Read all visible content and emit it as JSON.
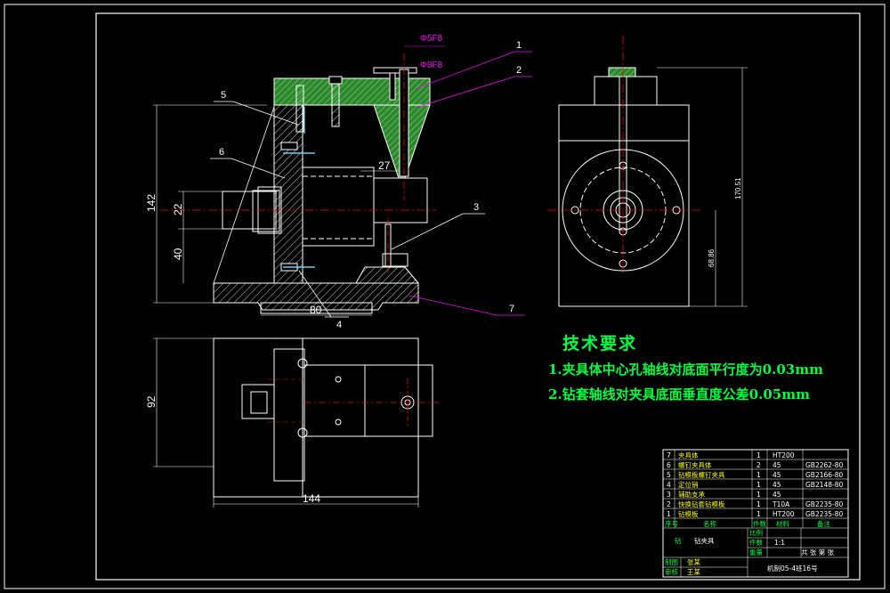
{
  "tech_requirements": {
    "title": "技术要求",
    "lines": [
      "1.夹具体中心孔轴线对底面平行度为0.03mm",
      "2.钻套轴线对夹具底面垂直度公差0.05mm"
    ]
  },
  "dimensions": {
    "fit_outer": "Φ5F8",
    "fit_inner": "Φ8F8",
    "d27": "27",
    "d22": "22",
    "d142": "142",
    "d40": "40",
    "d80": "80",
    "d92": "92",
    "d144": "144",
    "side_h1": "170.51",
    "side_h2": "68.86"
  },
  "balloons": [
    "1",
    "2",
    "3",
    "4",
    "5",
    "6",
    "7"
  ],
  "bom": {
    "rows": [
      {
        "no": "7",
        "name": "夹具体",
        "qty": "1",
        "material": "HT200",
        "std": ""
      },
      {
        "no": "6",
        "name": "螺钉夹具体",
        "qty": "2",
        "material": "45",
        "std": "GB2262-80"
      },
      {
        "no": "5",
        "name": "钻模板螺钉夹具",
        "qty": "1",
        "material": "45",
        "std": "GB2166-80"
      },
      {
        "no": "4",
        "name": "定位销",
        "qty": "1",
        "material": "45",
        "std": "GB2148-80"
      },
      {
        "no": "3",
        "name": "辅助支承",
        "qty": "1",
        "material": "45",
        "std": ""
      },
      {
        "no": "2",
        "name": "快换钻套钻模板",
        "qty": "1",
        "material": "T10A",
        "std": "GB2235-80"
      },
      {
        "no": "1",
        "name": "钻模板",
        "qty": "1",
        "material": "HT200",
        "std": "GB2235-80"
      }
    ],
    "header": {
      "no": "序号",
      "name": "名称",
      "qty": "件数",
      "material": "材料",
      "std": "备注"
    },
    "title_block": {
      "ratio_label": "比例",
      "ratio": "1:1",
      "qty_label": "件数",
      "weight_label": "重量",
      "part_name": "钻夹具",
      "drafter_label": "制图",
      "drafter": "张某",
      "checker_label": "审核",
      "checker": "王某",
      "sheet": "共 张 第 张",
      "class": "机制05-4班16号"
    }
  }
}
